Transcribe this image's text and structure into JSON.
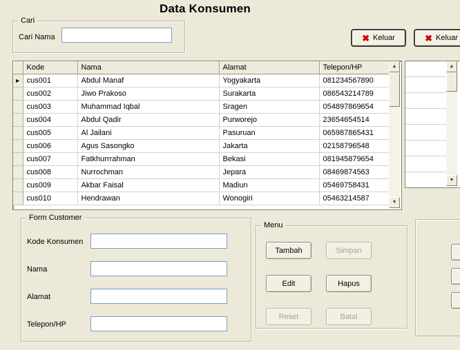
{
  "window": {
    "title": "Data Konsumen"
  },
  "search": {
    "group_label": "Cari",
    "field_label": "Cari Nama",
    "value": ""
  },
  "exit_button": {
    "label": "Keluar"
  },
  "icons": {
    "close_x": "✖",
    "current_row": "►",
    "scroll_up": "▲",
    "scroll_down": "▼"
  },
  "grid": {
    "columns": [
      "Kode",
      "Nama",
      "Alamat",
      "Telepon/HP"
    ],
    "rows": [
      {
        "kode": "cus001",
        "nama": "Abdul Manaf",
        "alamat": "Yogyakarta",
        "telepon": "081234567890"
      },
      {
        "kode": "cus002",
        "nama": "Jiwo Prakoso",
        "alamat": "Surakarta",
        "telepon": "086543214789"
      },
      {
        "kode": "cus003",
        "nama": "Muhammad Iqbal",
        "alamat": "Sragen",
        "telepon": "054897869654"
      },
      {
        "kode": "cus004",
        "nama": "Abdul Qadir",
        "alamat": "Purworejo",
        "telepon": "23654654514"
      },
      {
        "kode": "cus005",
        "nama": "Al Jailani",
        "alamat": "Pasuruan",
        "telepon": "065987865431"
      },
      {
        "kode": "cus006",
        "nama": "Agus Sasongko",
        "alamat": "Jakarta",
        "telepon": "02158796548"
      },
      {
        "kode": "cus007",
        "nama": "Fatkhurrrahman",
        "alamat": "Bekasi",
        "telepon": "081945879654"
      },
      {
        "kode": "cus008",
        "nama": "Nurrochman",
        "alamat": "Jepara",
        "telepon": "08469874563"
      },
      {
        "kode": "cus009",
        "nama": "Akbar Faisal",
        "alamat": "Madiun",
        "telepon": "05469758431"
      },
      {
        "kode": "cus010",
        "nama": "Hendrawan",
        "alamat": "Wonogiri",
        "telepon": "05463214587"
      }
    ]
  },
  "form": {
    "group_label": "Form Customer",
    "fields": [
      {
        "label": "Kode Konsumen",
        "value": ""
      },
      {
        "label": "Nama",
        "value": ""
      },
      {
        "label": "Alamat",
        "value": ""
      },
      {
        "label": "Telepon/HP",
        "value": ""
      }
    ]
  },
  "menu": {
    "group_label": "Menu",
    "buttons": [
      {
        "label": "Tambah",
        "enabled": true
      },
      {
        "label": "Simpan",
        "enabled": false
      },
      {
        "label": "Edit",
        "enabled": true
      },
      {
        "label": "Hapus",
        "enabled": true
      },
      {
        "label": "Reset",
        "enabled": false
      },
      {
        "label": "Batal",
        "enabled": false
      }
    ]
  },
  "colors": {
    "window_background": "#ECE9D8",
    "exit_icon_red": "#CC0000",
    "grid_line": "#D2D2CA"
  }
}
